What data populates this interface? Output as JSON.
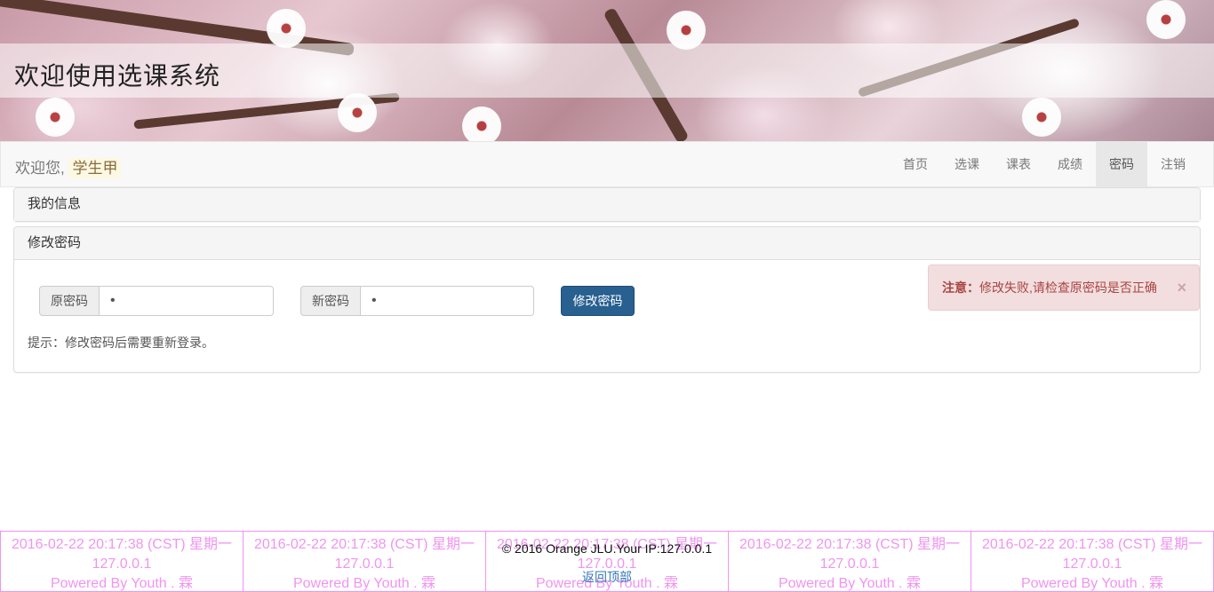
{
  "header": {
    "site_title": "欢迎使用选课系统"
  },
  "navbar": {
    "welcome_prefix": "欢迎您,",
    "user_name": "学生甲",
    "items": [
      {
        "label": "首页",
        "active": false
      },
      {
        "label": "选课",
        "active": false
      },
      {
        "label": "课表",
        "active": false
      },
      {
        "label": "成绩",
        "active": false
      },
      {
        "label": "密码",
        "active": true
      },
      {
        "label": "注销",
        "active": false
      }
    ]
  },
  "panels": {
    "info_title": "我的信息",
    "password_title": "修改密码"
  },
  "form": {
    "old_password_label": "原密码",
    "old_password_value": "•",
    "new_password_label": "新密码",
    "new_password_value": "•",
    "submit_label": "修改密码",
    "hint": "提示：修改密码后需要重新登录。"
  },
  "alert": {
    "title": "注意：",
    "message": "修改失败,请检查原密码是否正确",
    "close_symbol": "×"
  },
  "footer": {
    "cells": [
      {
        "line1": "2016-02-22 20:17:38 (CST) 星期一",
        "line2": "127.0.0.1",
        "line3": "Powered By Youth . 霖"
      },
      {
        "line1": "2016-02-22 20:17:38 (CST) 星期一",
        "line2": "127.0.0.1",
        "line3": "Powered By Youth . 霖"
      },
      {
        "line1": "2016-02-22 20:17:38 (CST) 星期一",
        "line2": "127.0.0.1",
        "line3": "Powered By Youth . 霖"
      },
      {
        "line1": "2016-02-22 20:17:38 (CST) 星期一",
        "line2": "127.0.0.1",
        "line3": "Powered By Youth . 霖"
      },
      {
        "line1": "2016-02-22 20:17:38 (CST) 星期一",
        "line2": "127.0.0.1",
        "line3": "Powered By Youth . 霖"
      }
    ],
    "copyright": "© 2016 Orange JLU.Your IP:127.0.0.1",
    "back_to_top": "返回顶部"
  },
  "colors": {
    "primary_button": "#286090",
    "alert_bg": "#f2dede",
    "alert_text": "#a94442",
    "footer_pink": "#ee82ee",
    "link": "#337ab7"
  }
}
